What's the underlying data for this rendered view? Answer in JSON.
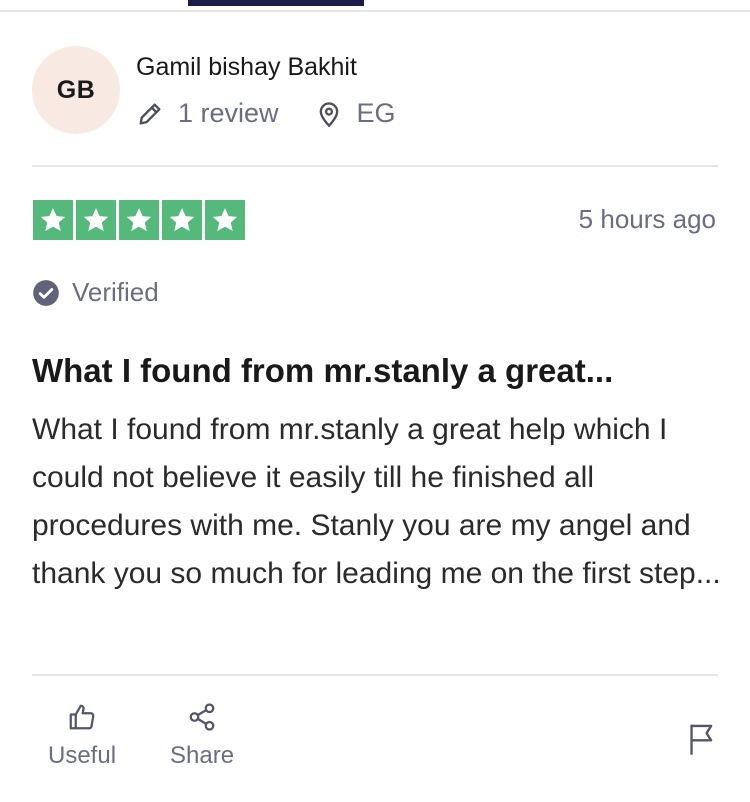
{
  "reviewer": {
    "initials": "GB",
    "name": "Gamil bishay Bakhit",
    "review_count": "1 review",
    "country": "EG",
    "icons": {
      "reviews": "pencil-icon",
      "country": "location-pin-icon"
    }
  },
  "review": {
    "rating": 5,
    "max_rating": 5,
    "date": "5 hours ago",
    "verified_label": "Verified",
    "title": "What I found from mr.stanly a great...",
    "body": "What I found from mr.stanly a great help which I could not believe it easily till he finished all procedures with me. Stanly you are my angel and thank you so much for leading me on the first step..."
  },
  "actions": {
    "useful_label": "Useful",
    "share_label": "Share",
    "icons": {
      "useful": "thumbs-up-icon",
      "share": "share-icon",
      "report": "flag-icon"
    }
  },
  "colors": {
    "star_green": "#54b97a",
    "avatar_bg": "#f8eae2",
    "muted_text": "#6c6c85",
    "tab_indicator": "#1c1c4a"
  }
}
